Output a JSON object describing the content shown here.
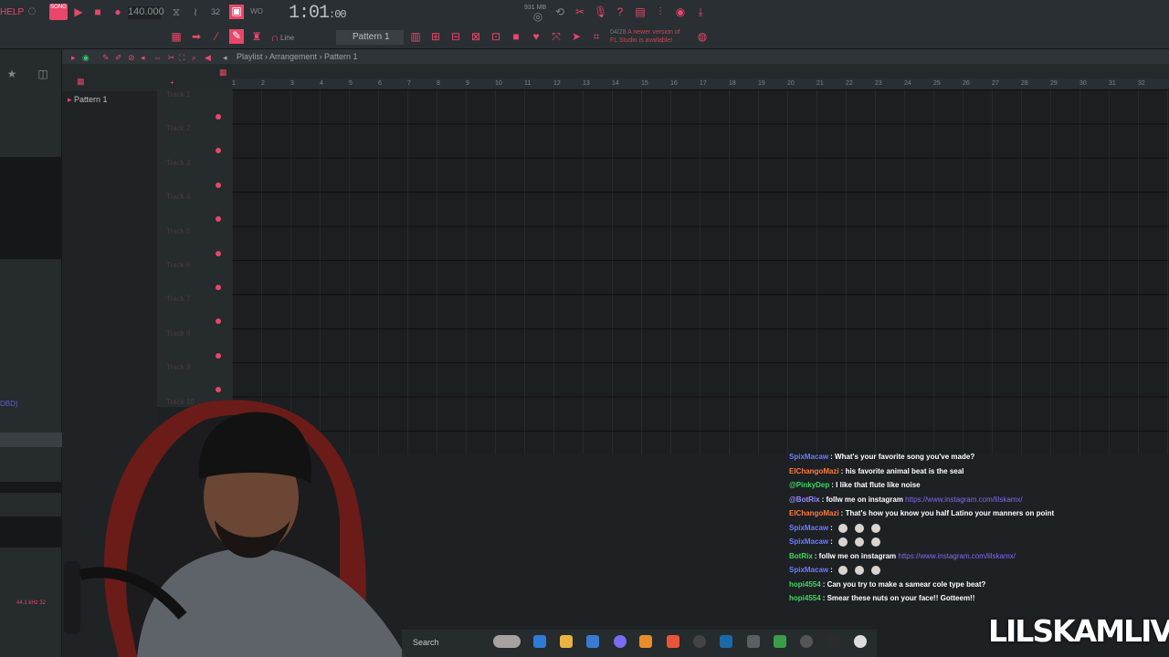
{
  "toolbar": {
    "menu_help": "HELP",
    "song_badge": "SONG",
    "tempo": "140.000",
    "time_main": "1:01",
    "time_sub": ":00",
    "memory": "931 MB",
    "pattern": "Pattern 1",
    "snap_mode": "Line",
    "news_date": "04/28",
    "news_text": "A newer version of",
    "news_text2": "FL Studio is available!"
  },
  "playlist": {
    "breadcrumb": "Playlist › Arrangement › Pattern 1",
    "pattern_item": "Pattern 1",
    "tracks": [
      "Track 1",
      "Track 2",
      "Track 3",
      "Track 4",
      "Track 5",
      "Track 6",
      "Track 7",
      "Track 8",
      "Track 9",
      "Track 10"
    ],
    "ruler_bars": [
      "1",
      "2",
      "3",
      "4",
      "5",
      "6",
      "7",
      "8",
      "9",
      "10",
      "11",
      "12",
      "13",
      "14",
      "15",
      "16",
      "17",
      "18",
      "19",
      "20",
      "21",
      "22",
      "23",
      "24",
      "25",
      "26",
      "27",
      "28",
      "29",
      "30",
      "31",
      "32"
    ]
  },
  "browser": {
    "label_1": "DBD)",
    "sample_rate": "44.1 kHz 32"
  },
  "chat": [
    {
      "user": "SpixMacaw",
      "user_color": "#6d7cff",
      "text": "What's your favorite song you've made?",
      "link": ""
    },
    {
      "user": "ElChangoMazi",
      "user_color": "#ff7a3d",
      "text": "his favorite animal beat is the seal",
      "link": ""
    },
    {
      "user": "@PinkyDep",
      "user_color": "#3fd95d",
      "text": "I like that flute like noise",
      "link": ""
    },
    {
      "user": "@BotRix",
      "user_color": "#9a8cff",
      "text": "follw me on instagram",
      "link": "https://www.instagram.com/lilskamx/"
    },
    {
      "user": "ElChangoMazi",
      "user_color": "#ff7a3d",
      "text": "That's how you know you half Latino your manners on point",
      "link": ""
    },
    {
      "user": "SpixMacaw",
      "user_color": "#6d7cff",
      "text": "",
      "link": ""
    },
    {
      "user": "SpixMacaw",
      "user_color": "#6d7cff",
      "text": "",
      "link": ""
    },
    {
      "user": "BotRix",
      "user_color": "#3fd95d",
      "text": "follw me on instagram",
      "link": "https://www.instagram.com/lilskamx/"
    },
    {
      "user": "SpixMacaw",
      "user_color": "#6d7cff",
      "text": "",
      "link": ""
    },
    {
      "user": "hopi4554",
      "user_color": "#3fd95d",
      "text": "Can you try to make a samear cole type beat?",
      "link": ""
    },
    {
      "user": "hopi4554",
      "user_color": "#3fd95d",
      "text": "Smear these nuts on your face!! Gotteem!!",
      "link": ""
    }
  ],
  "taskbar": {
    "search_label": "Search"
  },
  "overlay": {
    "brand": "LILSKAMLIVE"
  },
  "colors": {
    "accent": "#e8476a",
    "background": "#1d2124"
  }
}
